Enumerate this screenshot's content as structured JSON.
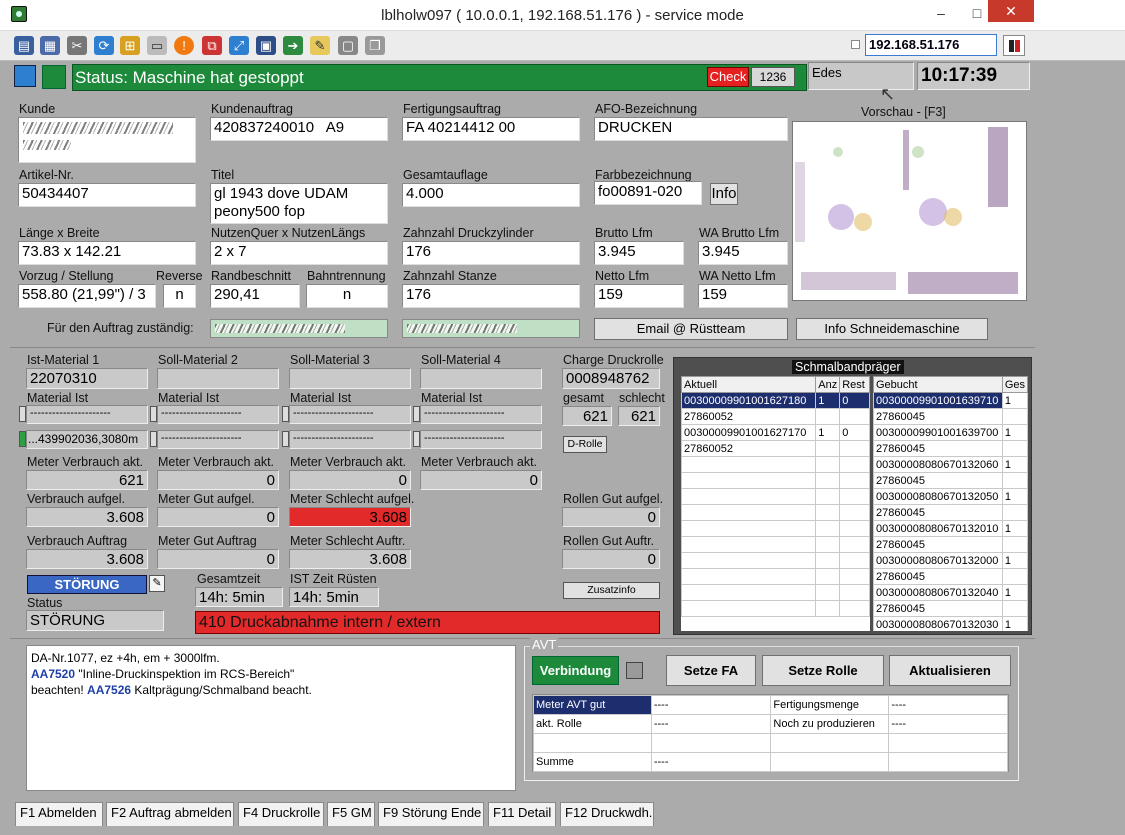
{
  "window": {
    "title": "lblholw097 ( 10.0.0.1, 192.168.51.176 ) - service mode",
    "minimize": "–",
    "maximize": "□",
    "close": "✕"
  },
  "toolbar": {
    "icons": [
      "monitor-icon",
      "windows-icon",
      "tools-icon",
      "refresh-icon",
      "windows-logo-icon",
      "drive-icon",
      "alert-icon",
      "network-icon",
      "fullscreen-icon",
      "display-icon",
      "export-icon",
      "note-icon",
      "box-icon",
      "copy-icon"
    ],
    "ip": "192.168.51.176"
  },
  "status": {
    "text": "Status: Maschine hat gestoppt",
    "check": "Check",
    "count": "1236",
    "user": "Edes",
    "time": "10:17:39"
  },
  "order": {
    "kunde_label": "Kunde",
    "kundenauftrag_label": "Kundenauftrag",
    "kundenauftrag": "420837240010   A9",
    "fertigungsauftrag_label": "Fertigungsauftrag",
    "fertigungsauftrag": "FA 40214412 00",
    "afo_label": "AFO-Bezeichnung",
    "afo": "DRUCKEN",
    "vorschau_label": "Vorschau - [F3]",
    "artikel_label": "Artikel-Nr.",
    "artikel": "50434407",
    "titel_label": "Titel",
    "titel": "gl 1943 dove UDAM\npeony500 fop",
    "gesamtauflage_label": "Gesamtauflage",
    "gesamtauflage": "4.000",
    "farb_label": "Farbbezeichnung",
    "farb": "fo00891-020",
    "info_btn": "Info",
    "laenge_label": "Länge x Breite",
    "laenge": "73.83 x 142.21",
    "nutzen_label": "NutzenQuer x NutzenLängs",
    "nutzen": "2 x 7",
    "zahnzahl_dz_label": "Zahnzahl Druckzylinder",
    "zahnzahl_dz": "176",
    "brutto_label": "Brutto Lfm",
    "brutto": "3.945",
    "wa_brutto_label": "WA Brutto Lfm",
    "wa_brutto": "3.945",
    "vorzug_label": "Vorzug / Stellung",
    "vorzug": "558.80 (21,99\") / 3",
    "reverse_label": "Reverse",
    "reverse": "n",
    "randbeschnitt_label": "Randbeschnitt",
    "randbeschnitt": "290,41",
    "bahntrennung_label": "Bahntrennung",
    "bahntrennung": "n",
    "zahnzahl_st_label": "Zahnzahl Stanze",
    "zahnzahl_st": "176",
    "netto_label": "Netto Lfm",
    "netto": "159",
    "wa_netto_label": "WA Netto Lfm",
    "wa_netto": "159",
    "zustaendig_label": "Für den Auftrag zuständig:",
    "email_btn": "Email @ Rüstteam",
    "schneide_btn": "Info Schneidemaschine"
  },
  "material": {
    "h1": "Ist-Material 1",
    "h2": "Soll-Material 2",
    "h3": "Soll-Material 3",
    "h4": "Soll-Material 4",
    "ist1": "22070310",
    "mi_label": "Material Ist",
    "dashes": "----------------------",
    "roll1": "...439902036,3080m",
    "mva_label": "Meter Verbrauch akt.",
    "mva1": "621",
    "mva2": "0",
    "mva3": "0",
    "mva4": "0",
    "va_label": "Verbrauch aufgel.",
    "va": "3.608",
    "mga_label": "Meter Gut aufgel.",
    "mga": "0",
    "msa_label": "Meter Schlecht aufgel.",
    "msa": "3.608",
    "vauf_label": "Verbrauch Auftrag",
    "vauf": "3.608",
    "mgauf_label": "Meter Gut Auftrag",
    "mgauf": "0",
    "msauf_label": "Meter Schlecht Auftr.",
    "msauf": "3.608",
    "charge_label": "Charge Druckrolle",
    "charge": "0008948762",
    "gesamt_label": "gesamt",
    "gesamt": "621",
    "schlecht_label": "schlecht",
    "schlecht": "621",
    "drolle_btn": "D-Rolle",
    "rga_label": "Rollen Gut aufgel.",
    "rga": "0",
    "rgauf_label": "Rollen Gut Auftr.",
    "rgauf": "0",
    "zusatz_btn": "Zusatzinfo",
    "stoerung_btn": "STÖRUNG",
    "status_label": "Status",
    "status": "STÖRUNG",
    "gz_label": "Gesamtzeit",
    "gz": "14h: 5min",
    "ist_label": "IST Zeit Rüsten",
    "ist": "14h: 5min",
    "error_msg": "410 Druckabnahme intern / extern"
  },
  "schmalband": {
    "title": "Schmalbandpräger",
    "left_headers": [
      "Aktuell",
      "Anz",
      "Rest"
    ],
    "left_rows": [
      [
        "00300009901001627180",
        "1",
        "0"
      ],
      [
        "27860052",
        "",
        ""
      ],
      [
        "00300009901001627170",
        "1",
        "0"
      ],
      [
        "27860052",
        "",
        ""
      ]
    ],
    "right_headers": [
      "Gebucht",
      "Ges"
    ],
    "right_rows": [
      [
        "00300009901001639710",
        "1"
      ],
      [
        "27860045",
        ""
      ],
      [
        "00300009901001639700",
        "1"
      ],
      [
        "27860045",
        ""
      ],
      [
        "00300008080670132060",
        "1"
      ],
      [
        "27860045",
        ""
      ],
      [
        "00300008080670132050",
        "1"
      ],
      [
        "27860045",
        ""
      ],
      [
        "00300008080670132010",
        "1"
      ],
      [
        "27860045",
        ""
      ],
      [
        "00300008080670132000",
        "1"
      ],
      [
        "27860045",
        ""
      ],
      [
        "00300008080670132040",
        "1"
      ],
      [
        "27860045",
        ""
      ],
      [
        "00300008080670132030",
        "1"
      ]
    ]
  },
  "notes": {
    "line1": "DA-Nr.1077, ez +4h, em + 3000lfm.",
    "code1": "AA7520",
    "text1": " \"Inline-Druckinspektion im RCS-Bereich\"",
    "text2a": "beachten! ",
    "code2": "AA7526",
    "text2b": " Kaltprägung/Schmalband beacht."
  },
  "avt": {
    "title": "AVT",
    "verbindung": "Verbindung",
    "setze_fa": "Setze FA",
    "setze_rolle": "Setze Rolle",
    "aktualisieren": "Aktualisieren",
    "rows": [
      [
        "Meter AVT gut",
        "----",
        "Fertigungsmenge",
        "----"
      ],
      [
        "akt. Rolle",
        "----",
        "Noch zu produzieren",
        "----"
      ],
      [
        "",
        "",
        "",
        ""
      ],
      [
        "Summe",
        "----",
        "",
        ""
      ]
    ]
  },
  "tabs": [
    "F1 Abmelden",
    "F2 Auftrag abmelden",
    "F4 Druckrolle",
    "F5 GM",
    "F9 Störung Ende",
    "F11 Detail",
    "F12 Druckwdh."
  ],
  "colors": {
    "status_green": "#1c8a3a",
    "error_red": "#e32a2a",
    "stoerung_blue": "#3a66c4",
    "selection": "#1d2e6e",
    "note_code": "#1f3fa8"
  }
}
